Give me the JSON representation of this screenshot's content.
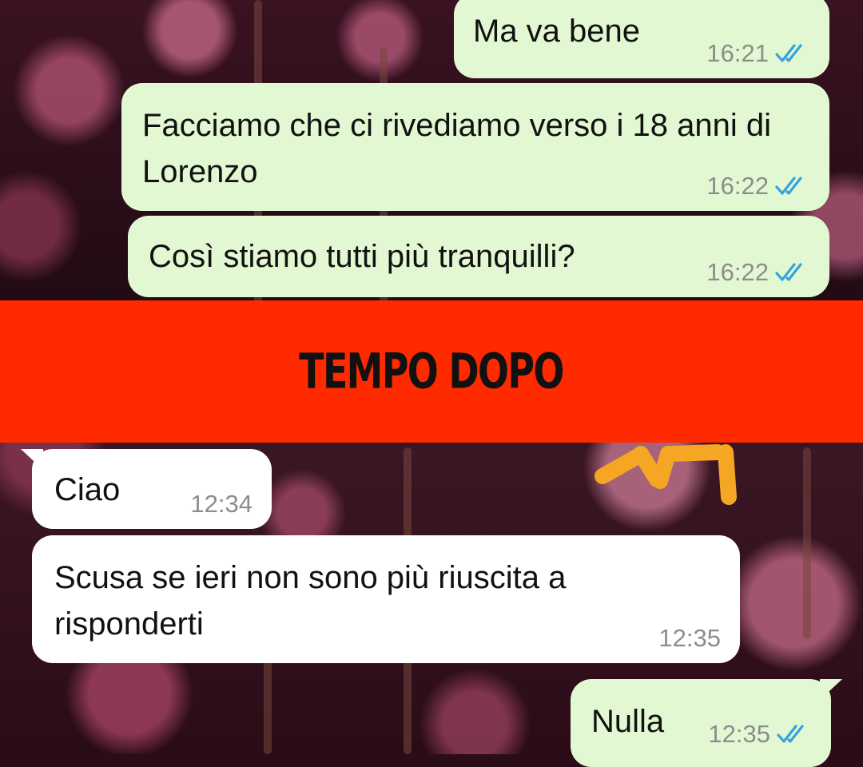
{
  "messages_top": [
    {
      "text": "Ma va bene",
      "time": "16:21",
      "direction": "outgoing",
      "status": "read"
    },
    {
      "text": "Facciamo che ci rivediamo verso i 18 anni di Lorenzo",
      "time": "16:22",
      "direction": "outgoing",
      "status": "read"
    },
    {
      "text": "Così stiamo tutti più tranquilli?",
      "time": "16:22",
      "direction": "outgoing",
      "status": "read"
    }
  ],
  "banner": {
    "text": "TEMPO DOPO",
    "color": "#ff2a00"
  },
  "messages_bottom": [
    {
      "text": "Ciao",
      "time": "12:34",
      "direction": "incoming"
    },
    {
      "text": "Scusa se ieri non sono più riuscita a risponderti",
      "time": "12:35",
      "direction": "incoming"
    },
    {
      "text": "Nulla",
      "time": "12:35",
      "direction": "outgoing",
      "status": "read"
    }
  ],
  "colors": {
    "outgoing_bubble": "#e2f8d2",
    "incoming_bubble": "#ffffff",
    "read_ticks": "#34a3e0",
    "timestamp": "#8c8c8c",
    "scribble": "#f5a623"
  },
  "icons": {
    "read_status": "double-check-icon"
  }
}
